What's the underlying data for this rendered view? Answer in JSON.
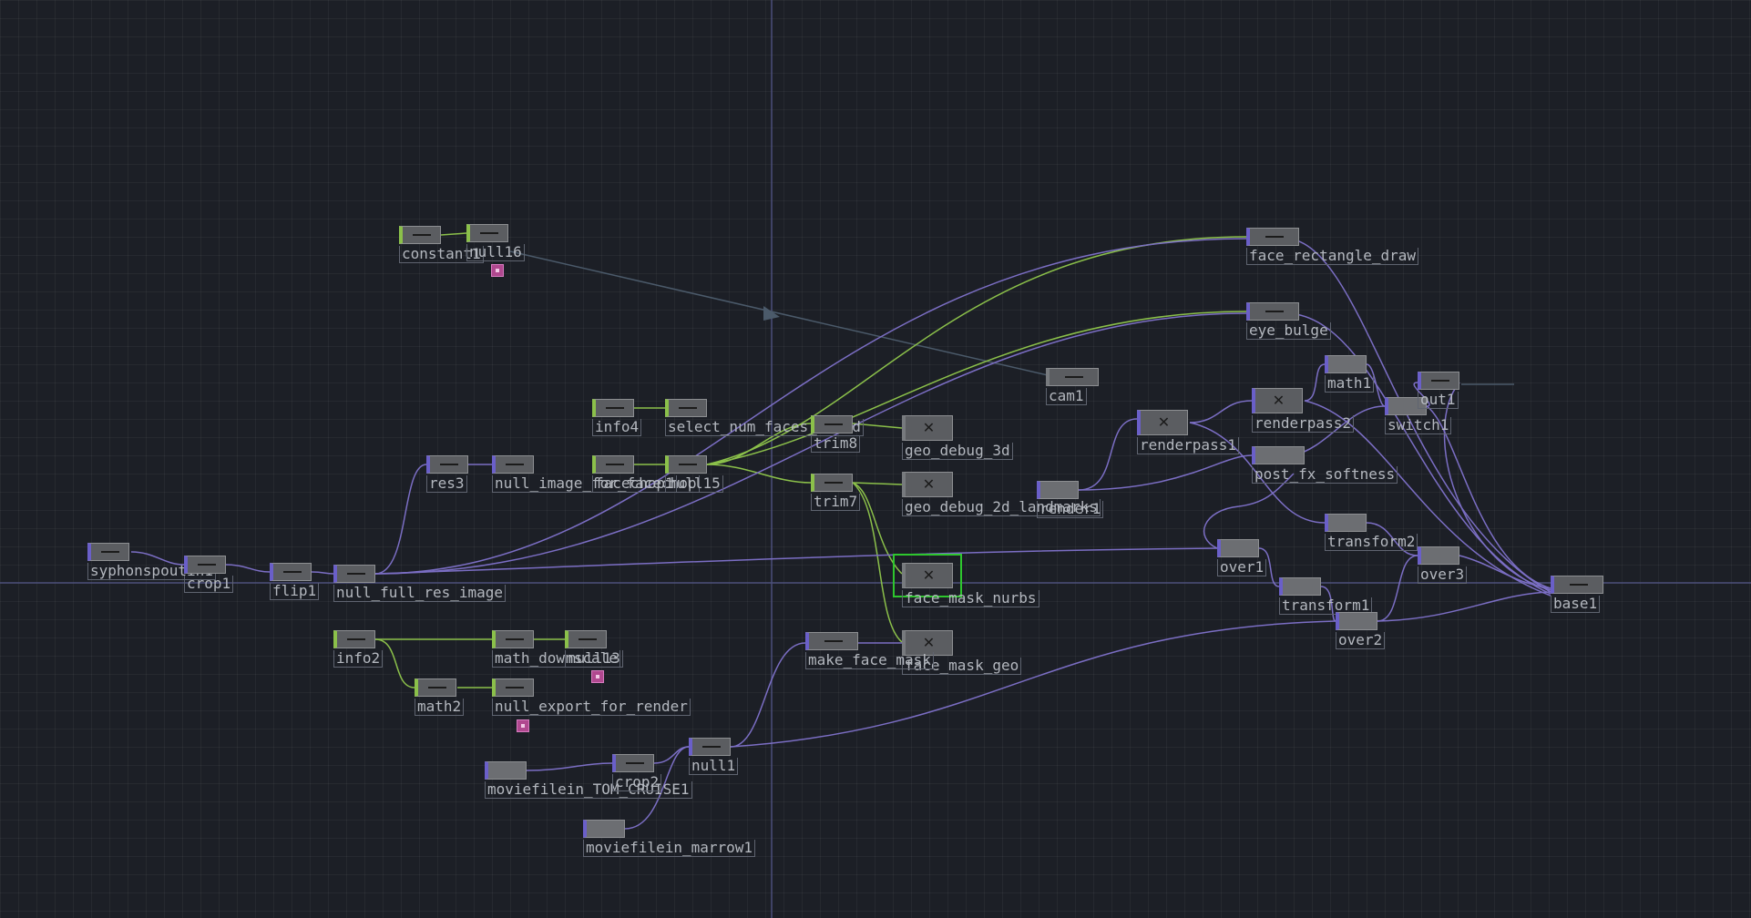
{
  "colors": {
    "background": "#1c1f26",
    "top_wire": "#7b6ec4",
    "chop_wire": "#8bc04a",
    "export_wire": "#4b5a6a",
    "selected_outline": "#2ec72e",
    "flag": "#b0488f"
  },
  "nodes": {
    "syphonspoutin1": {
      "label": "syphonspoutin1",
      "family": "top"
    },
    "crop1": {
      "label": "crop1",
      "family": "top"
    },
    "flip1": {
      "label": "flip1",
      "family": "top"
    },
    "null_full_res_image": {
      "label": "null_full_res_image",
      "family": "top"
    },
    "res3": {
      "label": "res3",
      "family": "top"
    },
    "null_image_for_facechop": {
      "label": "null_image_for_facechop",
      "family": "top"
    },
    "constant1": {
      "label": "constant1",
      "family": "chop"
    },
    "null16": {
      "label": "null16",
      "family": "chop"
    },
    "info4": {
      "label": "info4",
      "family": "chop"
    },
    "select_num_faces_found": {
      "label": "select_num_faces_found",
      "family": "chop"
    },
    "facechop1": {
      "label": "facechop1",
      "family": "chop"
    },
    "null15": {
      "label": "null15",
      "family": "chop"
    },
    "trim8": {
      "label": "trim8",
      "family": "chop"
    },
    "trim7": {
      "label": "trim7",
      "family": "chop"
    },
    "geo_debug_3d": {
      "label": "geo_debug_3d",
      "family": "sop"
    },
    "geo_debug_2d_landmarks": {
      "label": "geo_debug_2d_landmarks",
      "family": "sop"
    },
    "face_mask_nurbs": {
      "label": "face_mask_nurbs",
      "family": "sop"
    },
    "face_mask_geo": {
      "label": "face_mask_geo",
      "family": "sop"
    },
    "make_face_mask": {
      "label": "make_face_mask",
      "family": "top"
    },
    "info2": {
      "label": "info2",
      "family": "chop"
    },
    "math_downscale": {
      "label": "math_downscale",
      "family": "chop"
    },
    "null13": {
      "label": "null13",
      "family": "chop"
    },
    "math2": {
      "label": "math2",
      "family": "chop"
    },
    "null_export_for_render": {
      "label": "null_export_for_render",
      "family": "chop"
    },
    "moviefilein_TOM_CRUISE1": {
      "label": "moviefilein_TOM_CRUISE1",
      "family": "top"
    },
    "crop2": {
      "label": "crop2",
      "family": "top"
    },
    "null1": {
      "label": "null1",
      "family": "top"
    },
    "moviefilein_marrow1": {
      "label": "moviefilein_marrow1",
      "family": "top"
    },
    "face_rectangle_draw": {
      "label": "face_rectangle_draw",
      "family": "top"
    },
    "eye_bulge": {
      "label": "eye_bulge",
      "family": "top"
    },
    "cam1": {
      "label": "cam1",
      "family": "comp"
    },
    "render1": {
      "label": "render1",
      "family": "top"
    },
    "renderpass1": {
      "label": "renderpass1",
      "family": "top"
    },
    "renderpass2": {
      "label": "renderpass2",
      "family": "top"
    },
    "post_fx_softness": {
      "label": "post_fx_softness",
      "family": "top"
    },
    "math1": {
      "label": "math1",
      "family": "top"
    },
    "switch1": {
      "label": "switch1",
      "family": "top"
    },
    "out1": {
      "label": "out1",
      "family": "top"
    },
    "over1": {
      "label": "over1",
      "family": "top"
    },
    "transform2": {
      "label": "transform2",
      "family": "top"
    },
    "over3": {
      "label": "over3",
      "family": "top"
    },
    "transform1": {
      "label": "transform1",
      "family": "top"
    },
    "over2": {
      "label": "over2",
      "family": "top"
    },
    "base1": {
      "label": "base1",
      "family": "top"
    }
  }
}
